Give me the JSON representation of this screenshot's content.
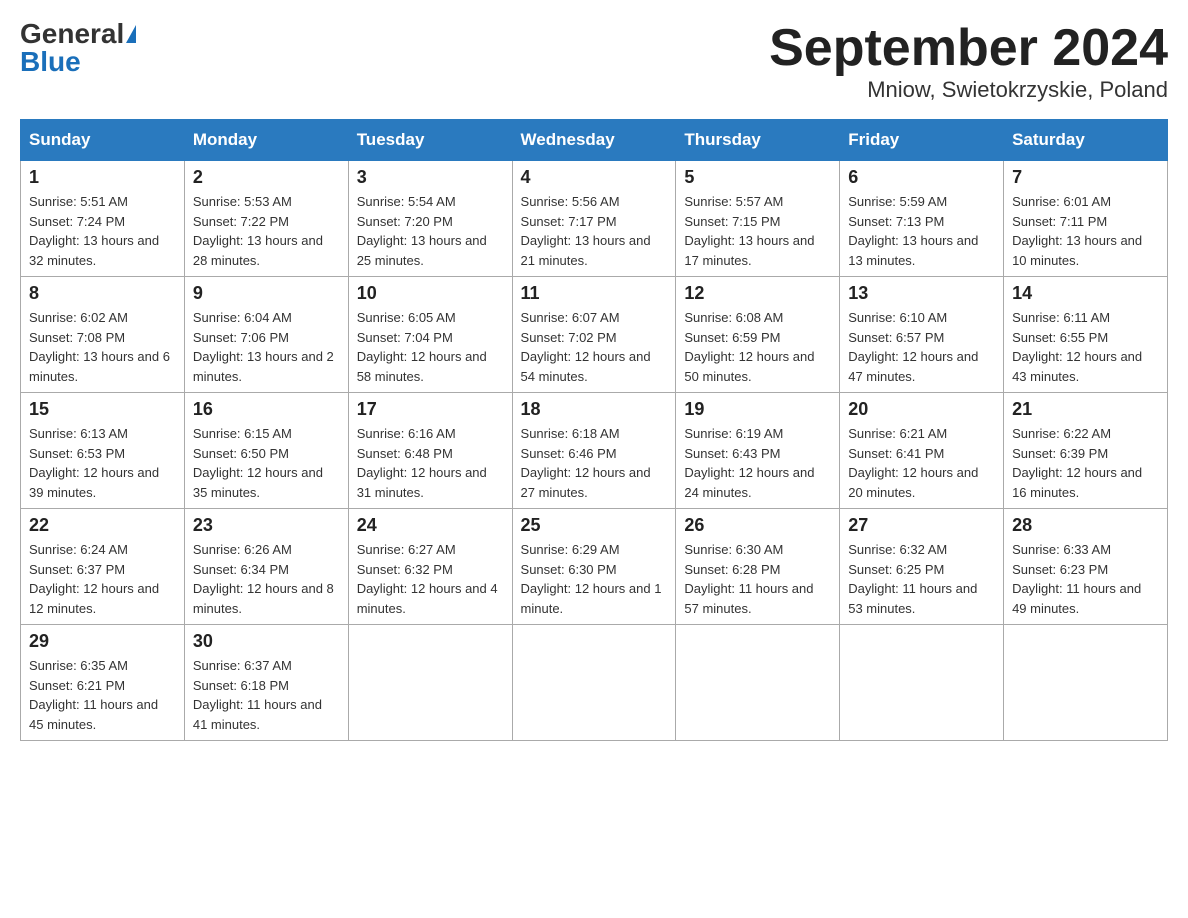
{
  "header": {
    "logo_general": "General",
    "logo_blue": "Blue",
    "title_month": "September 2024",
    "title_location": "Mniow, Swietokrzyskie, Poland"
  },
  "weekdays": [
    "Sunday",
    "Monday",
    "Tuesday",
    "Wednesday",
    "Thursday",
    "Friday",
    "Saturday"
  ],
  "weeks": [
    [
      {
        "day": "1",
        "sunrise": "5:51 AM",
        "sunset": "7:24 PM",
        "daylight": "13 hours and 32 minutes."
      },
      {
        "day": "2",
        "sunrise": "5:53 AM",
        "sunset": "7:22 PM",
        "daylight": "13 hours and 28 minutes."
      },
      {
        "day": "3",
        "sunrise": "5:54 AM",
        "sunset": "7:20 PM",
        "daylight": "13 hours and 25 minutes."
      },
      {
        "day": "4",
        "sunrise": "5:56 AM",
        "sunset": "7:17 PM",
        "daylight": "13 hours and 21 minutes."
      },
      {
        "day": "5",
        "sunrise": "5:57 AM",
        "sunset": "7:15 PM",
        "daylight": "13 hours and 17 minutes."
      },
      {
        "day": "6",
        "sunrise": "5:59 AM",
        "sunset": "7:13 PM",
        "daylight": "13 hours and 13 minutes."
      },
      {
        "day": "7",
        "sunrise": "6:01 AM",
        "sunset": "7:11 PM",
        "daylight": "13 hours and 10 minutes."
      }
    ],
    [
      {
        "day": "8",
        "sunrise": "6:02 AM",
        "sunset": "7:08 PM",
        "daylight": "13 hours and 6 minutes."
      },
      {
        "day": "9",
        "sunrise": "6:04 AM",
        "sunset": "7:06 PM",
        "daylight": "13 hours and 2 minutes."
      },
      {
        "day": "10",
        "sunrise": "6:05 AM",
        "sunset": "7:04 PM",
        "daylight": "12 hours and 58 minutes."
      },
      {
        "day": "11",
        "sunrise": "6:07 AM",
        "sunset": "7:02 PM",
        "daylight": "12 hours and 54 minutes."
      },
      {
        "day": "12",
        "sunrise": "6:08 AM",
        "sunset": "6:59 PM",
        "daylight": "12 hours and 50 minutes."
      },
      {
        "day": "13",
        "sunrise": "6:10 AM",
        "sunset": "6:57 PM",
        "daylight": "12 hours and 47 minutes."
      },
      {
        "day": "14",
        "sunrise": "6:11 AM",
        "sunset": "6:55 PM",
        "daylight": "12 hours and 43 minutes."
      }
    ],
    [
      {
        "day": "15",
        "sunrise": "6:13 AM",
        "sunset": "6:53 PM",
        "daylight": "12 hours and 39 minutes."
      },
      {
        "day": "16",
        "sunrise": "6:15 AM",
        "sunset": "6:50 PM",
        "daylight": "12 hours and 35 minutes."
      },
      {
        "day": "17",
        "sunrise": "6:16 AM",
        "sunset": "6:48 PM",
        "daylight": "12 hours and 31 minutes."
      },
      {
        "day": "18",
        "sunrise": "6:18 AM",
        "sunset": "6:46 PM",
        "daylight": "12 hours and 27 minutes."
      },
      {
        "day": "19",
        "sunrise": "6:19 AM",
        "sunset": "6:43 PM",
        "daylight": "12 hours and 24 minutes."
      },
      {
        "day": "20",
        "sunrise": "6:21 AM",
        "sunset": "6:41 PM",
        "daylight": "12 hours and 20 minutes."
      },
      {
        "day": "21",
        "sunrise": "6:22 AM",
        "sunset": "6:39 PM",
        "daylight": "12 hours and 16 minutes."
      }
    ],
    [
      {
        "day": "22",
        "sunrise": "6:24 AM",
        "sunset": "6:37 PM",
        "daylight": "12 hours and 12 minutes."
      },
      {
        "day": "23",
        "sunrise": "6:26 AM",
        "sunset": "6:34 PM",
        "daylight": "12 hours and 8 minutes."
      },
      {
        "day": "24",
        "sunrise": "6:27 AM",
        "sunset": "6:32 PM",
        "daylight": "12 hours and 4 minutes."
      },
      {
        "day": "25",
        "sunrise": "6:29 AM",
        "sunset": "6:30 PM",
        "daylight": "12 hours and 1 minute."
      },
      {
        "day": "26",
        "sunrise": "6:30 AM",
        "sunset": "6:28 PM",
        "daylight": "11 hours and 57 minutes."
      },
      {
        "day": "27",
        "sunrise": "6:32 AM",
        "sunset": "6:25 PM",
        "daylight": "11 hours and 53 minutes."
      },
      {
        "day": "28",
        "sunrise": "6:33 AM",
        "sunset": "6:23 PM",
        "daylight": "11 hours and 49 minutes."
      }
    ],
    [
      {
        "day": "29",
        "sunrise": "6:35 AM",
        "sunset": "6:21 PM",
        "daylight": "11 hours and 45 minutes."
      },
      {
        "day": "30",
        "sunrise": "6:37 AM",
        "sunset": "6:18 PM",
        "daylight": "11 hours and 41 minutes."
      },
      null,
      null,
      null,
      null,
      null
    ]
  ],
  "labels": {
    "sunrise": "Sunrise:",
    "sunset": "Sunset:",
    "daylight": "Daylight:"
  }
}
